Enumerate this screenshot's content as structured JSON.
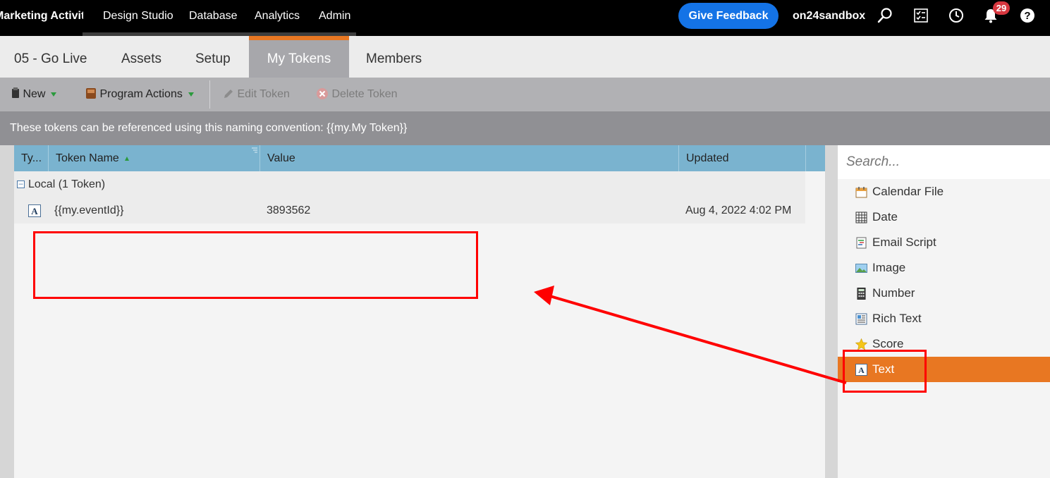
{
  "topnav": {
    "items": [
      "Marketing Activities",
      "Design Studio",
      "Database",
      "Analytics",
      "Admin"
    ],
    "feedback_label": "Give Feedback",
    "instance": "on24sandbox",
    "notification_count": "29"
  },
  "tabs": [
    "05 - Go Live",
    "Assets",
    "Setup",
    "My Tokens",
    "Members"
  ],
  "toolbar": {
    "new_label": "New",
    "program_actions_label": "Program Actions",
    "edit_label": "Edit Token",
    "delete_label": "Delete Token"
  },
  "info_text": "These tokens can be referenced using this naming convention: {{my.My Token}}",
  "grid": {
    "columns": [
      "Ty...",
      "Token Name",
      "Value",
      "Updated"
    ],
    "group_label": "Local (1 Token)",
    "rows": [
      {
        "name": "{{my.eventId}}",
        "value": "3893562",
        "updated": "Aug 4, 2022 4:02 PM"
      }
    ]
  },
  "token_types": {
    "search_placeholder": "Search...",
    "items": [
      "Calendar File",
      "Date",
      "Email Script",
      "Image",
      "Number",
      "Rich Text",
      "Score",
      "Text"
    ],
    "selected": "Text"
  },
  "colors": {
    "accent": "#e87722",
    "feedback": "#1473e6",
    "grid_header": "#7ab3cf",
    "annotation": "#ff0000"
  }
}
